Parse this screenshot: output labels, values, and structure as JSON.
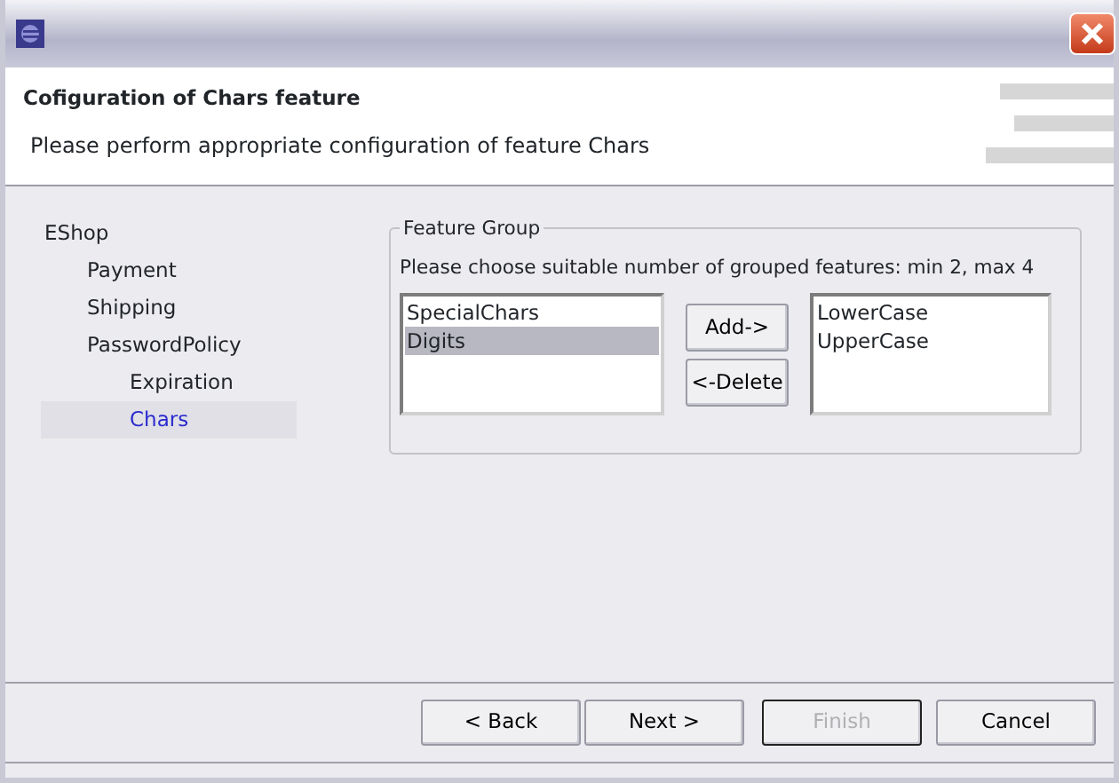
{
  "header": {
    "title": "Cofiguration of Chars feature",
    "description": "Please perform appropriate configuration of feature Chars"
  },
  "tree": [
    {
      "label": "EShop",
      "selected": false,
      "children": [
        {
          "label": "Payment",
          "selected": false
        },
        {
          "label": "Shipping",
          "selected": false
        },
        {
          "label": "PasswordPolicy",
          "selected": false,
          "children": [
            {
              "label": "Expiration",
              "selected": false
            },
            {
              "label": "Chars",
              "selected": true
            }
          ]
        }
      ]
    }
  ],
  "feature_group": {
    "legend": "Feature Group",
    "instruction": "Please choose suitable number of grouped features: min 2, max 4",
    "available": [
      {
        "label": "SpecialChars",
        "selected": false
      },
      {
        "label": "Digits",
        "selected": true
      }
    ],
    "add_button": "Add->",
    "delete_button": "<-Delete",
    "chosen": [
      {
        "label": "LowerCase",
        "selected": false
      },
      {
        "label": "UpperCase",
        "selected": false
      }
    ]
  },
  "buttons": [
    {
      "label": "< Back",
      "disabled": false,
      "default": false
    },
    {
      "label": "Next >",
      "disabled": false,
      "default": false
    },
    {
      "label": "Finish",
      "disabled": true,
      "default": true
    },
    {
      "label": "Cancel",
      "disabled": false,
      "default": false
    }
  ]
}
